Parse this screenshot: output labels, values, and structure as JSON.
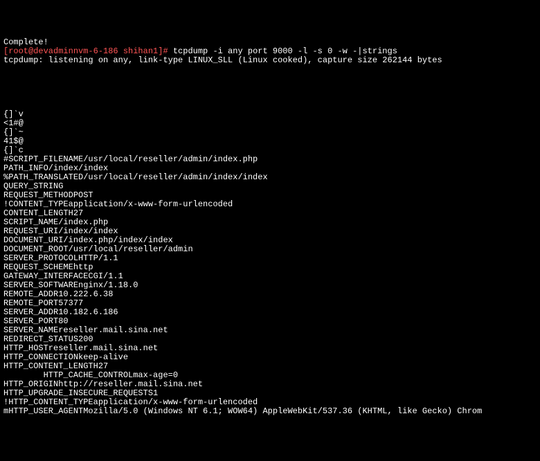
{
  "terminal": {
    "lines": [
      {
        "segments": [
          {
            "text": "Complete!",
            "class": ""
          }
        ]
      },
      {
        "segments": [
          {
            "text": "[root@devadminnvm-6-186 shihan1]# ",
            "class": "red"
          },
          {
            "text": "tcpdump -i any port 9000 -l -s 0 -w -|strings",
            "class": ""
          }
        ]
      },
      {
        "segments": [
          {
            "text": "tcpdump: listening on any, link-type LINUX_SLL (Linux cooked), capture size 262144 bytes",
            "class": ""
          }
        ]
      },
      {
        "segments": [
          {
            "text": "",
            "class": ""
          }
        ]
      },
      {
        "segments": [
          {
            "text": "",
            "class": ""
          }
        ]
      },
      {
        "segments": [
          {
            "text": "",
            "class": ""
          }
        ]
      },
      {
        "segments": [
          {
            "text": "",
            "class": ""
          }
        ]
      },
      {
        "segments": [
          {
            "text": "",
            "class": ""
          }
        ]
      },
      {
        "segments": [
          {
            "text": "{]`v",
            "class": ""
          }
        ]
      },
      {
        "segments": [
          {
            "text": "<1#@",
            "class": ""
          }
        ]
      },
      {
        "segments": [
          {
            "text": "{]`~",
            "class": ""
          }
        ]
      },
      {
        "segments": [
          {
            "text": "41$@",
            "class": ""
          }
        ]
      },
      {
        "segments": [
          {
            "text": "{]`c",
            "class": ""
          }
        ]
      },
      {
        "segments": [
          {
            "text": "#SCRIPT_FILENAME/usr/local/reseller/admin/index.php",
            "class": ""
          }
        ]
      },
      {
        "segments": [
          {
            "text": "PATH_INFO/index/index",
            "class": ""
          }
        ]
      },
      {
        "segments": [
          {
            "text": "%PATH_TRANSLATED/usr/local/reseller/admin/index/index",
            "class": ""
          }
        ]
      },
      {
        "segments": [
          {
            "text": "QUERY_STRING",
            "class": ""
          }
        ]
      },
      {
        "segments": [
          {
            "text": "REQUEST_METHODPOST",
            "class": ""
          }
        ]
      },
      {
        "segments": [
          {
            "text": "!CONTENT_TYPEapplication/x-www-form-urlencoded",
            "class": ""
          }
        ]
      },
      {
        "segments": [
          {
            "text": "CONTENT_LENGTH27",
            "class": ""
          }
        ]
      },
      {
        "segments": [
          {
            "text": "SCRIPT_NAME/index.php",
            "class": ""
          }
        ]
      },
      {
        "segments": [
          {
            "text": "REQUEST_URI/index/index",
            "class": ""
          }
        ]
      },
      {
        "segments": [
          {
            "text": "DOCUMENT_URI/index.php/index/index",
            "class": ""
          }
        ]
      },
      {
        "segments": [
          {
            "text": "DOCUMENT_ROOT/usr/local/reseller/admin",
            "class": ""
          }
        ]
      },
      {
        "segments": [
          {
            "text": "SERVER_PROTOCOLHTTP/1.1",
            "class": ""
          }
        ]
      },
      {
        "segments": [
          {
            "text": "REQUEST_SCHEMEhttp",
            "class": ""
          }
        ]
      },
      {
        "segments": [
          {
            "text": "GATEWAY_INTERFACECGI/1.1",
            "class": ""
          }
        ]
      },
      {
        "segments": [
          {
            "text": "SERVER_SOFTWAREnginx/1.18.0",
            "class": ""
          }
        ]
      },
      {
        "segments": [
          {
            "text": "REMOTE_ADDR10.222.6.38",
            "class": ""
          }
        ]
      },
      {
        "segments": [
          {
            "text": "REMOTE_PORT57377",
            "class": ""
          }
        ]
      },
      {
        "segments": [
          {
            "text": "SERVER_ADDR10.182.6.186",
            "class": ""
          }
        ]
      },
      {
        "segments": [
          {
            "text": "SERVER_PORT80",
            "class": ""
          }
        ]
      },
      {
        "segments": [
          {
            "text": "SERVER_NAMEreseller.mail.sina.net",
            "class": ""
          }
        ]
      },
      {
        "segments": [
          {
            "text": "REDIRECT_STATUS200",
            "class": ""
          }
        ]
      },
      {
        "segments": [
          {
            "text": "HTTP_HOSTreseller.mail.sina.net",
            "class": ""
          }
        ]
      },
      {
        "segments": [
          {
            "text": "HTTP_CONNECTIONkeep-alive",
            "class": ""
          }
        ]
      },
      {
        "segments": [
          {
            "text": "HTTP_CONTENT_LENGTH27",
            "class": ""
          }
        ]
      },
      {
        "segments": [
          {
            "text": "        HTTP_CACHE_CONTROLmax-age=0",
            "class": ""
          }
        ]
      },
      {
        "segments": [
          {
            "text": "HTTP_ORIGINhttp://reseller.mail.sina.net",
            "class": ""
          }
        ]
      },
      {
        "segments": [
          {
            "text": "HTTP_UPGRADE_INSECURE_REQUESTS1",
            "class": ""
          }
        ]
      },
      {
        "segments": [
          {
            "text": "!HTTP_CONTENT_TYPEapplication/x-www-form-urlencoded",
            "class": ""
          }
        ]
      },
      {
        "segments": [
          {
            "text": "mHTTP_USER_AGENTMozilla/5.0 (Windows NT 6.1; WOW64) AppleWebKit/537.36 (KHTML, like Gecko) Chrom",
            "class": ""
          }
        ]
      }
    ]
  }
}
